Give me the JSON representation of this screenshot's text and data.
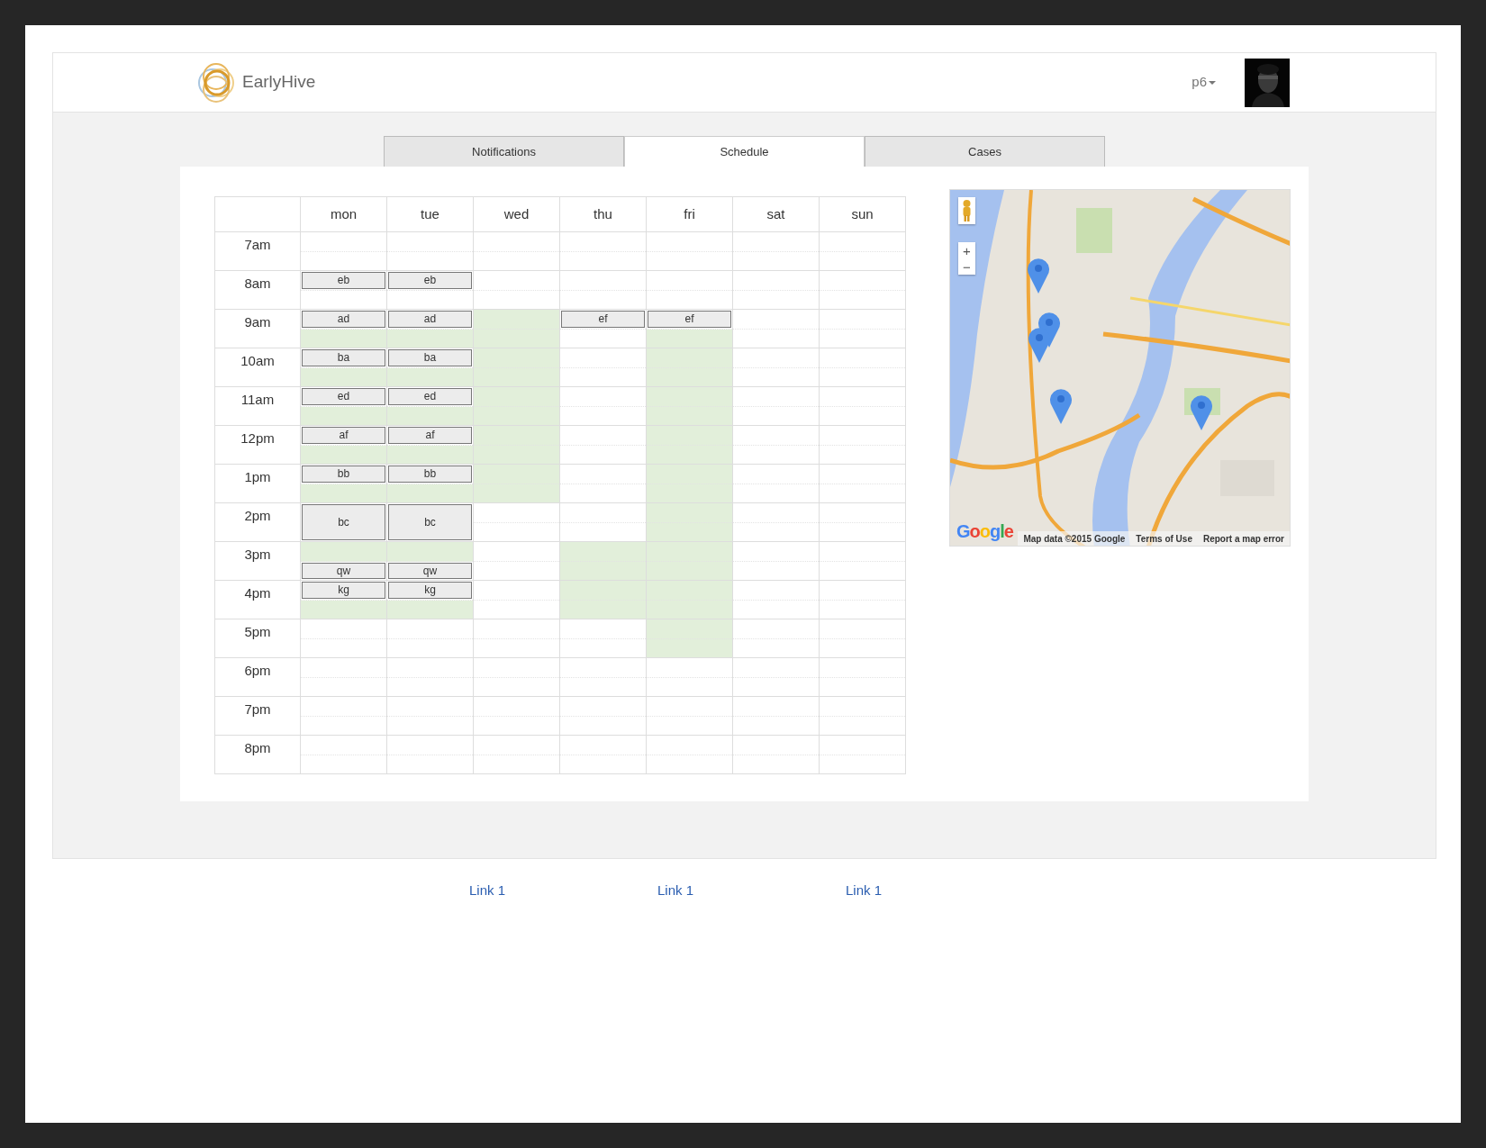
{
  "header": {
    "brand": "EarlyHive",
    "user": "p6"
  },
  "tabs": [
    {
      "label": "Notifications",
      "selected": false
    },
    {
      "label": "Schedule",
      "selected": true
    },
    {
      "label": "Cases",
      "selected": false
    }
  ],
  "schedule": {
    "hours": [
      "7am",
      "8am",
      "9am",
      "10am",
      "11am",
      "12pm",
      "1pm",
      "2pm",
      "3pm",
      "4pm",
      "5pm",
      "6pm",
      "7pm",
      "8pm"
    ],
    "days": [
      {
        "label": "mon",
        "slots": [
          {
            "available": false
          },
          {
            "available": false
          },
          {
            "event": {
              "label": "eb",
              "kind": "half"
            }
          },
          {
            "available": false
          },
          {
            "event": {
              "label": "ad",
              "kind": "half"
            }
          },
          {
            "available": true
          },
          {
            "event": {
              "label": "ba",
              "kind": "half"
            }
          },
          {
            "available": true
          },
          {
            "event": {
              "label": "ed",
              "kind": "half"
            }
          },
          {
            "available": true
          },
          {
            "event": {
              "label": "af",
              "kind": "half"
            }
          },
          {
            "available": true
          },
          {
            "event": {
              "label": "bb",
              "kind": "half"
            }
          },
          {
            "available": true
          },
          {
            "event": {
              "label": "bc",
              "kind": "hour"
            }
          },
          {
            "available": true
          },
          {
            "event": {
              "label": "qw",
              "kind": "half"
            }
          },
          {
            "event": {
              "label": "kg",
              "kind": "half"
            }
          },
          {
            "available": true
          },
          {
            "available": false
          },
          {
            "available": false
          },
          {
            "available": false
          },
          {
            "available": false
          },
          {
            "available": false
          },
          {
            "available": false
          },
          {
            "available": false
          },
          {
            "available": false
          }
        ]
      },
      {
        "label": "tue",
        "slots": [
          {
            "available": false
          },
          {
            "available": false
          },
          {
            "event": {
              "label": "eb",
              "kind": "half"
            }
          },
          {
            "available": false
          },
          {
            "event": {
              "label": "ad",
              "kind": "half"
            }
          },
          {
            "available": true
          },
          {
            "event": {
              "label": "ba",
              "kind": "half"
            }
          },
          {
            "available": true
          },
          {
            "event": {
              "label": "ed",
              "kind": "half"
            }
          },
          {
            "available": true
          },
          {
            "event": {
              "label": "af",
              "kind": "half"
            }
          },
          {
            "available": true
          },
          {
            "event": {
              "label": "bb",
              "kind": "half"
            }
          },
          {
            "available": true
          },
          {
            "event": {
              "label": "bc",
              "kind": "hour"
            }
          },
          {
            "available": true
          },
          {
            "event": {
              "label": "qw",
              "kind": "half"
            }
          },
          {
            "event": {
              "label": "kg",
              "kind": "half"
            }
          },
          {
            "available": true
          },
          {
            "available": false
          },
          {
            "available": false
          },
          {
            "available": false
          },
          {
            "available": false
          },
          {
            "available": false
          },
          {
            "available": false
          },
          {
            "available": false
          },
          {
            "available": false
          }
        ]
      },
      {
        "label": "wed",
        "slots": [
          {
            "available": false
          },
          {
            "available": false
          },
          {
            "available": false
          },
          {
            "available": false
          },
          {
            "available": true
          },
          {
            "available": true
          },
          {
            "available": true
          },
          {
            "available": true
          },
          {
            "available": true
          },
          {
            "available": true
          },
          {
            "available": true
          },
          {
            "available": true
          },
          {
            "available": true
          },
          {
            "available": true
          },
          {
            "available": false
          },
          {
            "available": false
          },
          {
            "available": false
          },
          {
            "available": false
          },
          {
            "available": false
          },
          {
            "available": false
          },
          {
            "available": false
          },
          {
            "available": false
          },
          {
            "available": false
          },
          {
            "available": false
          },
          {
            "available": false
          },
          {
            "available": false
          },
          {
            "available": false
          },
          {
            "available": false
          }
        ]
      },
      {
        "label": "thu",
        "slots": [
          {
            "available": false
          },
          {
            "available": false
          },
          {
            "available": false
          },
          {
            "available": false
          },
          {
            "event": {
              "label": "ef",
              "kind": "half"
            }
          },
          {
            "available": false
          },
          {
            "available": false
          },
          {
            "available": false
          },
          {
            "available": false
          },
          {
            "available": false
          },
          {
            "available": false
          },
          {
            "available": false
          },
          {
            "available": false
          },
          {
            "available": false
          },
          {
            "available": false
          },
          {
            "available": false
          },
          {
            "available": true
          },
          {
            "available": true
          },
          {
            "available": true
          },
          {
            "available": true
          },
          {
            "available": false
          },
          {
            "available": false
          },
          {
            "available": false
          },
          {
            "available": false
          },
          {
            "available": false
          },
          {
            "available": false
          },
          {
            "available": false
          },
          {
            "available": false
          }
        ]
      },
      {
        "label": "fri",
        "slots": [
          {
            "available": false
          },
          {
            "available": false
          },
          {
            "available": false
          },
          {
            "available": false
          },
          {
            "event": {
              "label": "ef",
              "kind": "half"
            }
          },
          {
            "available": true
          },
          {
            "available": true
          },
          {
            "available": true
          },
          {
            "available": true
          },
          {
            "available": true
          },
          {
            "available": true
          },
          {
            "available": true
          },
          {
            "available": true
          },
          {
            "available": true
          },
          {
            "available": true
          },
          {
            "available": true
          },
          {
            "available": true
          },
          {
            "available": true
          },
          {
            "available": true
          },
          {
            "available": true
          },
          {
            "available": true
          },
          {
            "available": true
          },
          {
            "available": false
          },
          {
            "available": false
          },
          {
            "available": false
          },
          {
            "available": false
          },
          {
            "available": false
          },
          {
            "available": false
          }
        ]
      },
      {
        "label": "sat",
        "slots": [
          {
            "available": false
          },
          {
            "available": false
          },
          {
            "available": false
          },
          {
            "available": false
          },
          {
            "available": false
          },
          {
            "available": false
          },
          {
            "available": false
          },
          {
            "available": false
          },
          {
            "available": false
          },
          {
            "available": false
          },
          {
            "available": false
          },
          {
            "available": false
          },
          {
            "available": false
          },
          {
            "available": false
          },
          {
            "available": false
          },
          {
            "available": false
          },
          {
            "available": false
          },
          {
            "available": false
          },
          {
            "available": false
          },
          {
            "available": false
          },
          {
            "available": false
          },
          {
            "available": false
          },
          {
            "available": false
          },
          {
            "available": false
          },
          {
            "available": false
          },
          {
            "available": false
          },
          {
            "available": false
          },
          {
            "available": false
          }
        ]
      },
      {
        "label": "sun",
        "slots": [
          {
            "available": false
          },
          {
            "available": false
          },
          {
            "available": false
          },
          {
            "available": false
          },
          {
            "available": false
          },
          {
            "available": false
          },
          {
            "available": false
          },
          {
            "available": false
          },
          {
            "available": false
          },
          {
            "available": false
          },
          {
            "available": false
          },
          {
            "available": false
          },
          {
            "available": false
          },
          {
            "available": false
          },
          {
            "available": false
          },
          {
            "available": false
          },
          {
            "available": false
          },
          {
            "available": false
          },
          {
            "available": false
          },
          {
            "available": false
          },
          {
            "available": false
          },
          {
            "available": false
          },
          {
            "available": false
          },
          {
            "available": false
          },
          {
            "available": false
          },
          {
            "available": false
          },
          {
            "available": false
          },
          {
            "available": false
          }
        ]
      }
    ]
  },
  "map": {
    "zoom_in": "+",
    "zoom_out": "−",
    "logo": "Google",
    "attribution": [
      "Map data ©2015 Google",
      "Terms of Use",
      "Report a map error"
    ]
  },
  "footer_links": [
    "Link 1",
    "Link 1",
    "Link 1"
  ]
}
